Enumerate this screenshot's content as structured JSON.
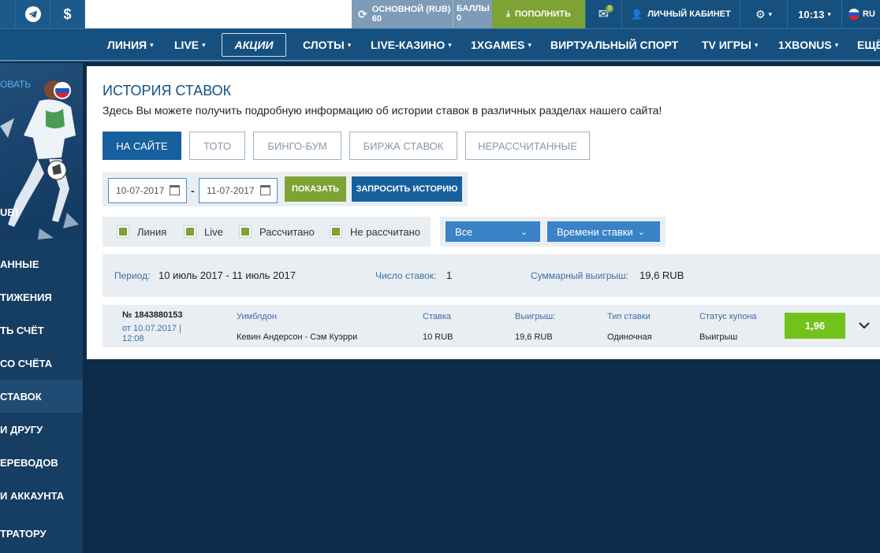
{
  "topbar": {
    "currency_symbol": "$",
    "balance_label": "ОСНОВНОЙ (RUB)",
    "balance_value": "60",
    "points_label": "БАЛЛЫ",
    "points_value": "0",
    "deposit_label": "ПОПОЛНИТЬ",
    "messages_count": "0",
    "cabinet_label": "ЛИЧНЫЙ КАБИНЕТ",
    "time": "10:13",
    "lang": "RU"
  },
  "nav": {
    "items": [
      "ЛИНИЯ",
      "LIVE",
      "АКЦИИ",
      "СЛОТЫ",
      "LIVE-КАЗИНО",
      "1XGAMES",
      "ВИРТУАЛЬНЫЙ СПОРТ",
      "TV ИГРЫ",
      "1XBONUS",
      "ЕЩЁ"
    ]
  },
  "sidebar": {
    "link_text": "ОВАТЬ",
    "currency_text": "UB)",
    "items": [
      "АННЫЕ",
      "ТИЖЕНИЯ",
      "ТЬ СЧЁТ",
      "СО СЧЁТА",
      "СТАВОК",
      "И ДРУГУ",
      "ЕРЕВОДОВ",
      "И АККАУНТА",
      "ТРАТОРУ"
    ]
  },
  "page": {
    "title": "ИСТОРИЯ СТАВОК",
    "description": "Здесь Вы можете получить подробную информацию об истории ставок в различных разделах нашего сайта!"
  },
  "tabs": [
    "НА САЙТЕ",
    "ТОТО",
    "БИНГО-БУМ",
    "БИРЖА СТАВОК",
    "НЕРАССЧИТАННЫЕ"
  ],
  "dates": {
    "from": "10-07-2017",
    "to": "11-07-2017",
    "show_label": "ПОКАЗАТЬ",
    "request_label": "ЗАПРОСИТЬ ИСТОРИЮ"
  },
  "filters": {
    "checkboxes": [
      "Линия",
      "Live",
      "Рассчитано",
      "Не рассчитано"
    ],
    "select_all": "Все",
    "select_time": "Времени ставки"
  },
  "summary": {
    "period_label": "Период:",
    "period_value": "10 июль 2017 - 11 июль 2017",
    "count_label": "Число ставок:",
    "count_value": "1",
    "total_label": "Суммарный выигрыш:",
    "total_value": "19,6 RUB"
  },
  "bet": {
    "number": "№ 1843880153",
    "date": "от 10.07.2017 | 12:08",
    "tournament": "Уимблдон",
    "match": "Кевин Андерсон - Сэм Куэрри",
    "stake_label": "Ставка",
    "stake_value": "10 RUB",
    "win_label": "Выигрыш:",
    "win_value": "19,6 RUB",
    "type_label": "Тип ставки",
    "type_value": "Одиночная",
    "status_label": "Статус купона",
    "status_value": "Выигрыш",
    "odds": "1,96"
  }
}
